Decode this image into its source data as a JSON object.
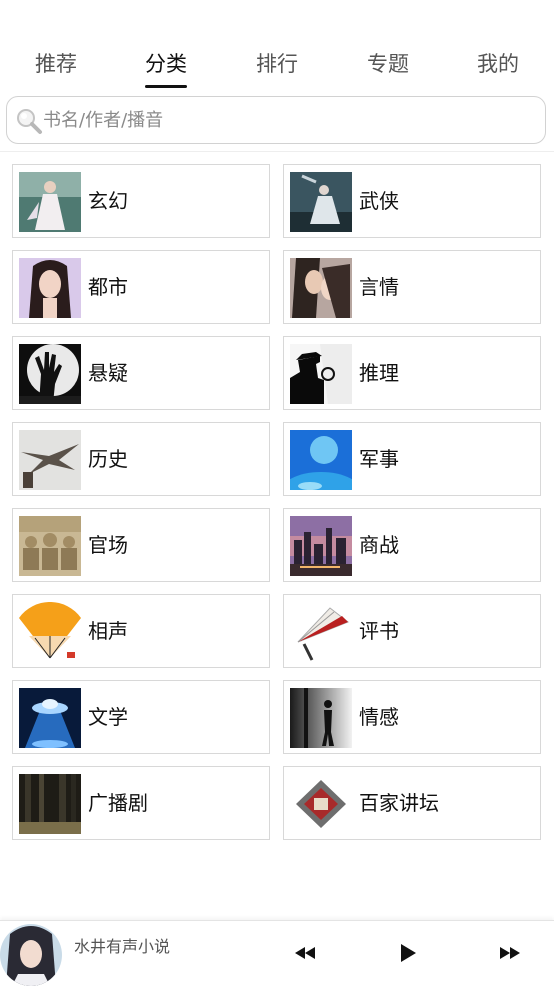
{
  "tabs": [
    {
      "label": "推荐"
    },
    {
      "label": "分类"
    },
    {
      "label": "排行"
    },
    {
      "label": "专题"
    },
    {
      "label": "我的"
    }
  ],
  "active_tab": "分类",
  "search": {
    "placeholder": "书名/作者/播音"
  },
  "categories": [
    {
      "label": "玄幻",
      "image": "fantasy-woman-thumbnail"
    },
    {
      "label": "武侠",
      "image": "martial-arts-thumbnail"
    },
    {
      "label": "都市",
      "image": "urban-girl-thumbnail"
    },
    {
      "label": "言情",
      "image": "romance-couple-thumbnail"
    },
    {
      "label": "悬疑",
      "image": "zombie-hand-moon-thumbnail"
    },
    {
      "label": "推理",
      "image": "detective-silhouette-thumbnail"
    },
    {
      "label": "历史",
      "image": "warplane-thumbnail"
    },
    {
      "label": "军事",
      "image": "blue-planet-thumbnail"
    },
    {
      "label": "官场",
      "image": "officials-group-thumbnail"
    },
    {
      "label": "商战",
      "image": "city-skyline-thumbnail"
    },
    {
      "label": "相声",
      "image": "crosstalk-fan-thumbnail"
    },
    {
      "label": "评书",
      "image": "storytelling-fan-thumbnail"
    },
    {
      "label": "文学",
      "image": "ufo-beam-thumbnail"
    },
    {
      "label": "情感",
      "image": "lonely-figure-thumbnail"
    },
    {
      "label": "广播剧",
      "image": "dark-forest-thumbnail"
    },
    {
      "label": "百家讲坛",
      "image": "lecture-logo-thumbnail"
    }
  ],
  "player": {
    "title": "水井有声小说",
    "controls": [
      "rewind-icon",
      "play-icon",
      "fast-forward-icon"
    ]
  },
  "colors": {
    "active_tab": "#111111",
    "tab": "#555555",
    "border": "#d8d8d8"
  }
}
